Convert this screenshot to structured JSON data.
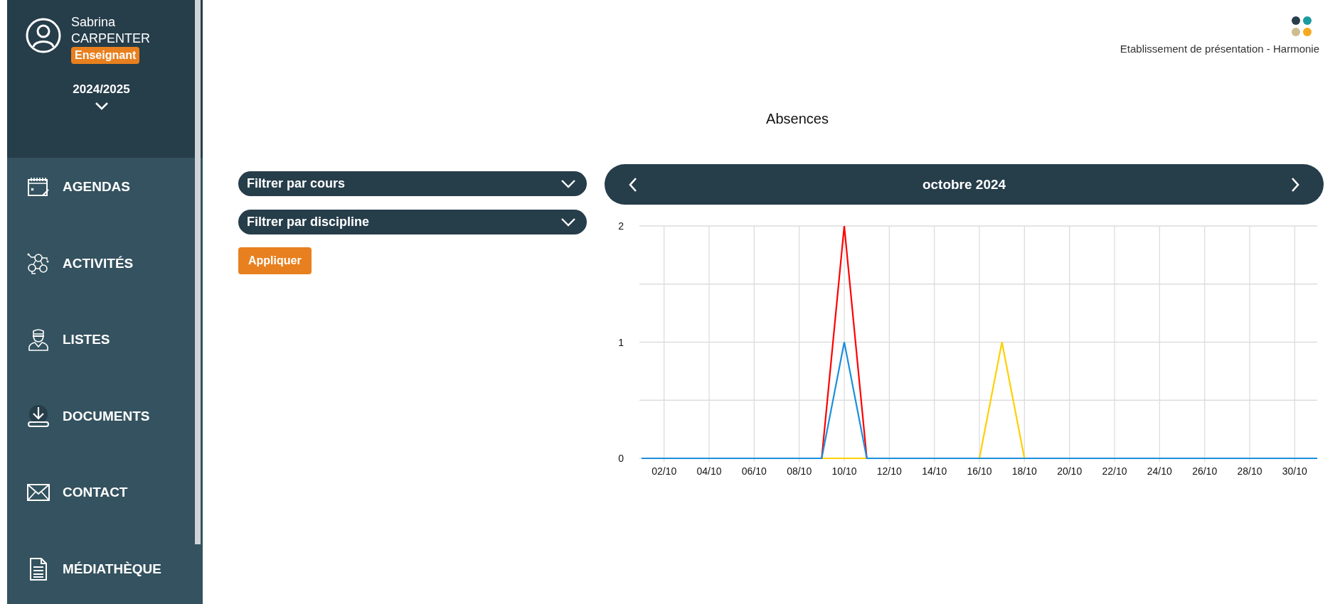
{
  "user": {
    "first_name": "Sabrina",
    "last_name": "CARPENTER",
    "role": "Enseignant"
  },
  "school_year": {
    "label": "2024/2025"
  },
  "nav": [
    {
      "label": "AGENDAS",
      "kind": "calendar"
    },
    {
      "label": "ACTIVITÉS",
      "kind": "network"
    },
    {
      "label": "LISTES",
      "kind": "person"
    },
    {
      "label": "DOCUMENTS",
      "kind": "download"
    },
    {
      "label": "CONTACT",
      "kind": "mail"
    },
    {
      "label": "MÉDIATHÈQUE",
      "kind": "document"
    }
  ],
  "establishment": "Etablissement de présentation - Harmonie",
  "page_title": "Absences",
  "filters": [
    {
      "label": "Filtrer par cours"
    },
    {
      "label": "Filtrer par discipline"
    }
  ],
  "apply_button": "Appliquer",
  "month_nav": {
    "label": "octobre 2024"
  },
  "chart_data": {
    "type": "line",
    "categories": [
      null,
      "02/10",
      null,
      "04/10",
      null,
      "06/10",
      null,
      "08/10",
      null,
      "10/10",
      null,
      "12/10",
      null,
      "14/10",
      null,
      "16/10",
      null,
      "18/10",
      null,
      "20/10",
      null,
      "22/10",
      null,
      "24/10",
      null,
      "26/10",
      null,
      "28/10",
      null,
      "30/10",
      null
    ],
    "ylim": [
      0,
      2
    ],
    "grid": true,
    "yticks": [
      0,
      1,
      2
    ],
    "series": [
      {
        "color": "#ff0000",
        "values": [
          null,
          null,
          null,
          null,
          null,
          null,
          null,
          null,
          0,
          2,
          0,
          null,
          null,
          null,
          null,
          null,
          null,
          null,
          null,
          null,
          null,
          null,
          null,
          null,
          null,
          null,
          null,
          null,
          null,
          null,
          null
        ]
      },
      {
        "color": "#ffd000",
        "values": [
          null,
          null,
          null,
          null,
          null,
          null,
          null,
          null,
          0,
          0,
          0,
          null,
          null,
          null,
          null,
          0,
          1,
          0,
          null,
          null,
          null,
          null,
          null,
          null,
          null,
          null,
          null,
          null,
          null,
          null,
          null
        ]
      },
      {
        "color": "#1a8fdd",
        "values": [
          0,
          0,
          0,
          0,
          0,
          0,
          0,
          0,
          0,
          1,
          0,
          0,
          0,
          0,
          0,
          0,
          0,
          0,
          0,
          0,
          0,
          0,
          0,
          0,
          0,
          0,
          0,
          0,
          0,
          0,
          0
        ]
      }
    ]
  }
}
